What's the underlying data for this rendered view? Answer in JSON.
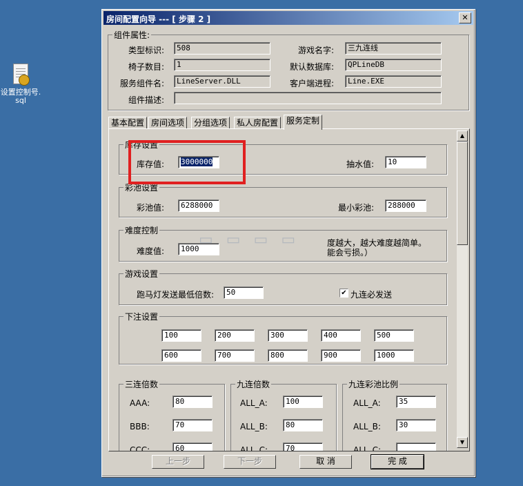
{
  "desktop_icon": {
    "label": "设置控制号.\nsql"
  },
  "dialog": {
    "title": "房间配置向导 --- [ 步骤 2 ]",
    "close_glyph": "✕",
    "component": {
      "group_label": "组件属性:",
      "type_id_label": "类型标识:",
      "type_id": "508",
      "chairs_label": "椅子数目:",
      "chairs": "1",
      "service_label": "服务组件名:",
      "service": "LineServer.DLL",
      "desc_label": "组件描述:",
      "desc": "",
      "game_name_label": "游戏名字:",
      "game_name": "三九连线",
      "db_label": "默认数据库:",
      "db": "QPLineDB",
      "client_label": "客户端进程:",
      "client": "Line.EXE"
    },
    "tabs": [
      "基本配置",
      "房间选项",
      "分组选项",
      "私人房配置",
      "服务定制"
    ],
    "active_tab": 4,
    "stock": {
      "group": "库存设置",
      "stock_label": "库存值:",
      "stock": "3000000",
      "pump_label": "抽水值:",
      "pump": "10"
    },
    "jackpot": {
      "group": "彩池设置",
      "pool_label": "彩池值:",
      "pool": "6288000",
      "min_label": "最小彩池:",
      "min": "288000"
    },
    "difficulty": {
      "group": "难度控制",
      "label": "难度值:",
      "value": "1000",
      "hint_line1": "度越大，越大难度越简单。",
      "hint_line2": "能会亏损。）"
    },
    "game": {
      "group": "游戏设置",
      "marquee_label": "跑马灯发送最低倍数:",
      "marquee": "50",
      "nine_label": "九连必发送",
      "nine_checked": true,
      "check_glyph": "✔"
    },
    "bets": {
      "group": "下注设置",
      "values": [
        "100",
        "200",
        "300",
        "400",
        "500",
        "600",
        "700",
        "800",
        "900",
        "1000"
      ]
    },
    "triple": {
      "group": "三连倍数",
      "rows": [
        {
          "label": "AAA:",
          "value": "80"
        },
        {
          "label": "BBB:",
          "value": "70"
        },
        {
          "label": "CCC:",
          "value": "60"
        }
      ]
    },
    "nine": {
      "group": "九连倍数",
      "rows": [
        {
          "label": "ALL_A:",
          "value": "100"
        },
        {
          "label": "ALL_B:",
          "value": "80"
        },
        {
          "label": "ALL_C:",
          "value": "70"
        }
      ]
    },
    "ninepool": {
      "group": "九连彩池比例",
      "rows": [
        {
          "label": "ALL_A:",
          "value": "35"
        },
        {
          "label": "ALL_B:",
          "value": "30"
        },
        {
          "label": "ALL_C:",
          "value": ""
        }
      ]
    },
    "buttons": {
      "prev": "上一步",
      "next": "下一步",
      "cancel": "取 消",
      "finish": "完 成"
    }
  }
}
